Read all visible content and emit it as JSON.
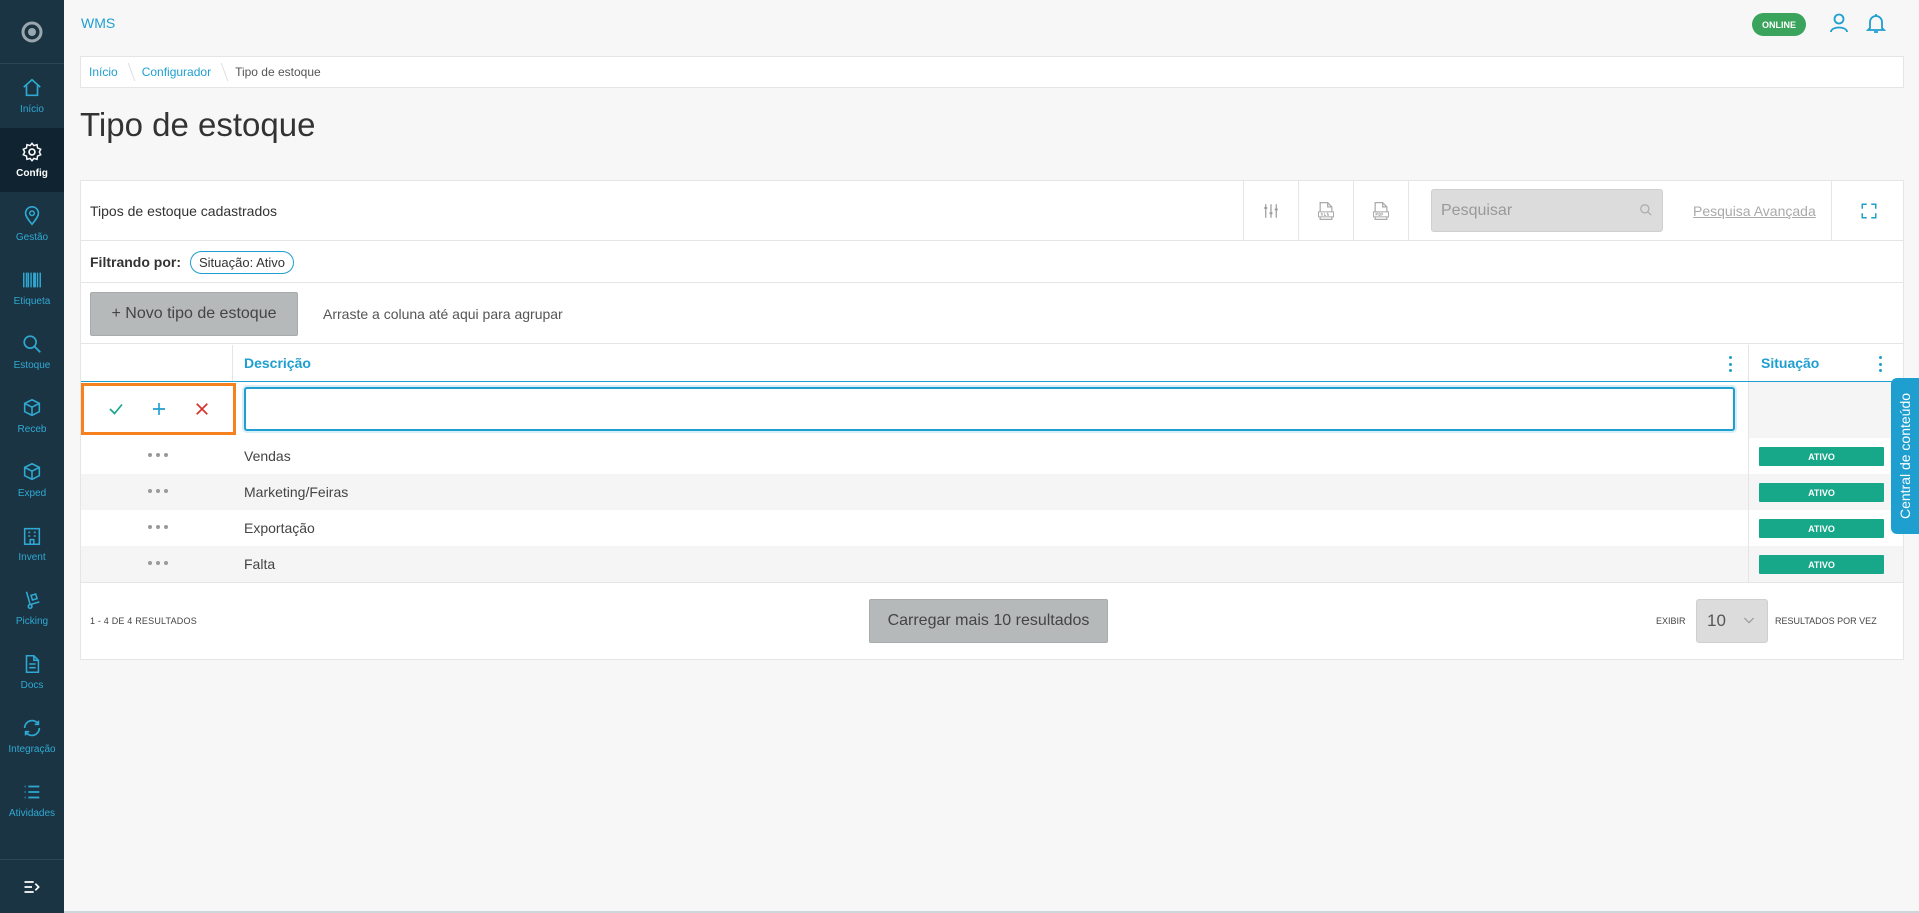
{
  "app": {
    "title": "WMS",
    "status": "ONLINE"
  },
  "sidebar": {
    "items": [
      {
        "label": "Início",
        "icon": "home-icon"
      },
      {
        "label": "Config",
        "icon": "gear-icon",
        "active": true
      },
      {
        "label": "Gestão",
        "icon": "location-pin-icon"
      },
      {
        "label": "Etiqueta",
        "icon": "barcode-icon"
      },
      {
        "label": "Estoque",
        "icon": "search-icon"
      },
      {
        "label": "Receb",
        "icon": "box-in-icon"
      },
      {
        "label": "Exped",
        "icon": "box-out-icon"
      },
      {
        "label": "Invent",
        "icon": "building-icon"
      },
      {
        "label": "Picking",
        "icon": "picking-icon"
      },
      {
        "label": "Docs",
        "icon": "document-icon"
      },
      {
        "label": "Integração",
        "icon": "sync-icon"
      },
      {
        "label": "Atividades",
        "icon": "list-icon"
      }
    ]
  },
  "breadcrumb": [
    "Início",
    "Configurador",
    "Tipo de estoque"
  ],
  "page": {
    "title": "Tipo de estoque"
  },
  "panel": {
    "title": "Tipos de estoque cadastrados",
    "search_placeholder": "Pesquisar",
    "advanced_search": "Pesquisa Avançada",
    "filter_label": "Filtrando por:",
    "filter_chip": "Situação: Ativo",
    "new_button": "+ Novo tipo de estoque",
    "group_hint": "Arraste a coluna até aqui para agrupar",
    "columns": {
      "description": "Descrição",
      "status": "Situação"
    },
    "edit_value": "",
    "rows": [
      {
        "description": "Vendas",
        "status": "ATIVO"
      },
      {
        "description": "Marketing/Feiras",
        "status": "ATIVO"
      },
      {
        "description": "Exportação",
        "status": "ATIVO"
      },
      {
        "description": "Falta",
        "status": "ATIVO"
      }
    ],
    "results_text": "1 - 4 DE 4 RESULTADOS",
    "load_more": "Carregar mais 10 resultados",
    "show_label": "EXIBIR",
    "page_size": "10",
    "per_page_label": "RESULTADOS POR VEZ"
  },
  "side_tab": "Central de conteúdo",
  "colors": {
    "accent": "#1e9fcf",
    "sidebar": "#1b3443",
    "active_badge": "#17a789",
    "online": "#3aa35c",
    "highlight": "#f5821f"
  }
}
